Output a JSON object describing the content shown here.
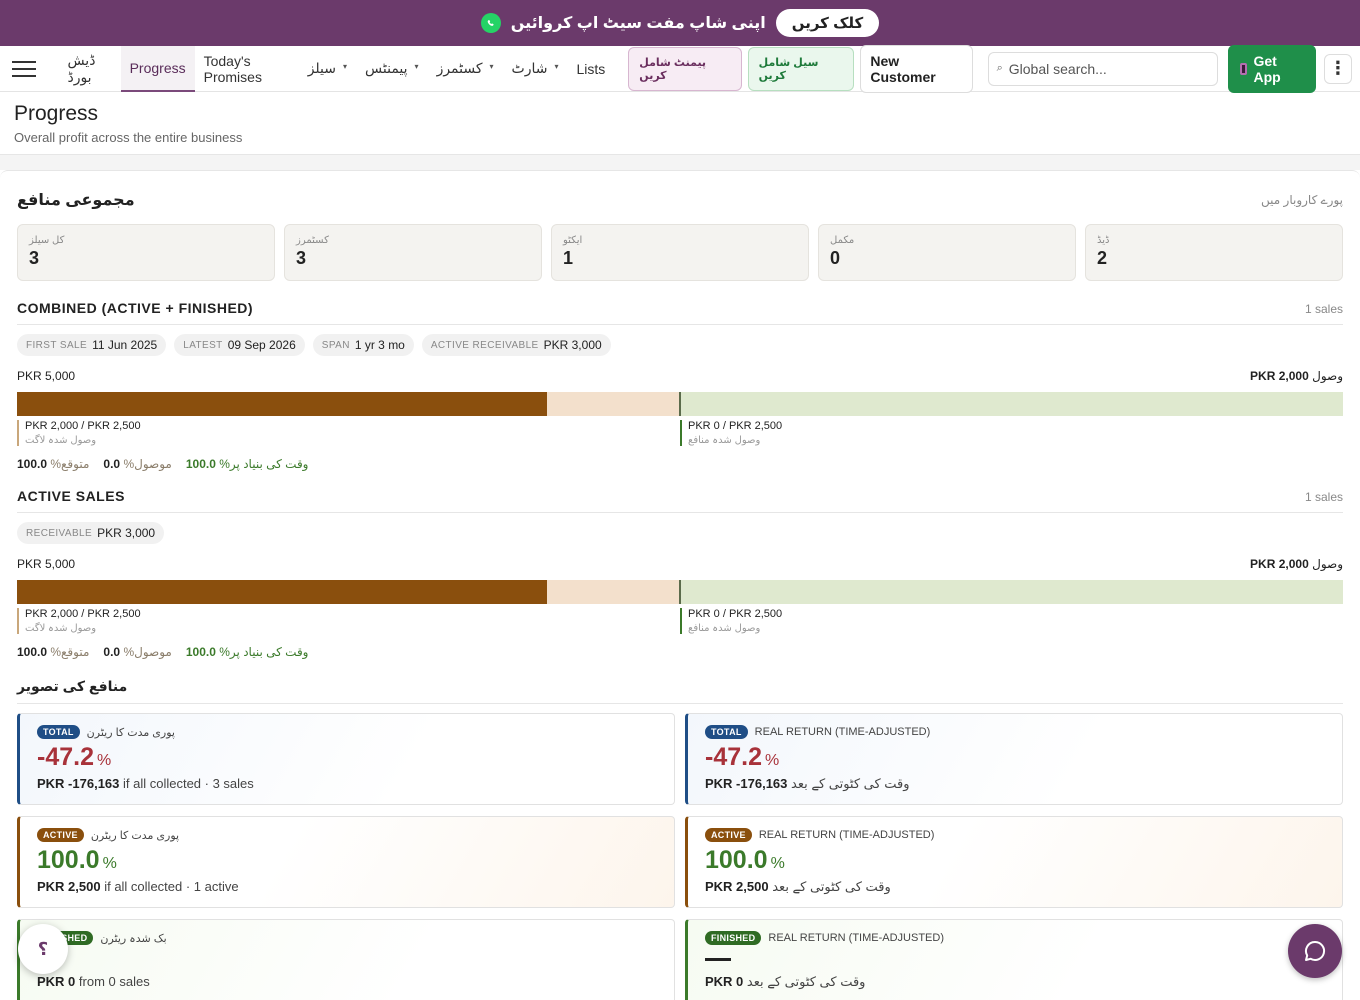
{
  "promo": {
    "text": "اپنی شاپ مفت سیٹ اپ کروائیں",
    "cta": "کلک کریں"
  },
  "nav": {
    "items": [
      {
        "label": "ڈیش بورڈ",
        "has_menu": false,
        "active": false
      },
      {
        "label": "Progress",
        "has_menu": false,
        "active": true
      },
      {
        "label": "Today's Promises",
        "has_menu": false,
        "active": false
      },
      {
        "label": "سیلز",
        "has_menu": true,
        "active": false
      },
      {
        "label": "پیمنٹس",
        "has_menu": true,
        "active": false
      },
      {
        "label": "کسٹمرز",
        "has_menu": true,
        "active": false
      },
      {
        "label": "شارٹ",
        "has_menu": true,
        "active": false
      },
      {
        "label": "Lists",
        "has_menu": false,
        "active": false
      }
    ],
    "add_payment": "پیمنٹ شامل کریں",
    "add_sale": "سیل شامل کریں",
    "new_customer": "New Customer",
    "search_placeholder": "Global search...",
    "get_app": "Get App"
  },
  "page": {
    "title": "Progress",
    "subtitle": "Overall profit across the entire business"
  },
  "overall": {
    "title": "مجموعی منافع",
    "scope": "پورے کاروبار میں",
    "stats": [
      {
        "label": "کل سیلز",
        "value": "3"
      },
      {
        "label": "کسٹمرز",
        "value": "3"
      },
      {
        "label": "ایکٹو",
        "value": "1"
      },
      {
        "label": "مکمل",
        "value": "0"
      },
      {
        "label": "ڈیڈ",
        "value": "2"
      }
    ]
  },
  "combined": {
    "heading": "COMBINED (ACTIVE + FINISHED)",
    "count": "1 sales",
    "chips": [
      {
        "key": "FIRST SALE",
        "value": "11 Jun 2025"
      },
      {
        "key": "LATEST",
        "value": "09 Sep 2026"
      },
      {
        "key": "SPAN",
        "value": "1 yr 3 mo"
      },
      {
        "key": "ACTIVE RECEIVABLE",
        "value": "PKR 3,000"
      }
    ],
    "total_label": "PKR 5,000",
    "received_amount": "PKR 2,000",
    "received_word": "وصول",
    "cost_collected_fraction": 0.8,
    "profit_collected_fraction": 0.0,
    "cost_legend": "PKR 2,000 / PKR 2,500",
    "cost_legend_caption": "وصول شدہ لاگت",
    "profit_legend": "PKR 0 / PKR 2,500",
    "profit_legend_caption": "وصول شدہ منافع",
    "expected_value": "100.0",
    "expected_label": "%متوقع",
    "received_value": "0.0",
    "received_label": "%موصول",
    "ontime_value": "100.0",
    "ontime_label": "%وقت کی بنیاد پر"
  },
  "active": {
    "heading": "ACTIVE SALES",
    "count": "1 sales",
    "chips": [
      {
        "key": "RECEIVABLE",
        "value": "PKR 3,000"
      }
    ],
    "total_label": "PKR 5,000",
    "received_amount": "PKR 2,000",
    "received_word": "وصول",
    "cost_collected_fraction": 0.8,
    "profit_collected_fraction": 0.0,
    "cost_legend": "PKR 2,000 / PKR 2,500",
    "cost_legend_caption": "وصول شدہ لاگت",
    "profit_legend": "PKR 0 / PKR 2,500",
    "profit_legend_caption": "وصول شدہ منافع",
    "expected_value": "100.0",
    "expected_label": "%متوقع",
    "received_value": "0.0",
    "received_label": "%موصول",
    "ontime_value": "100.0",
    "ontime_label": "%وقت کی بنیاد پر"
  },
  "visual": {
    "title": "منافع کی تصویر",
    "cards": [
      {
        "kind": "total",
        "badge": "TOTAL",
        "label": "پوری مدت کا ریٹرن",
        "value": "-47.2",
        "unit": "%",
        "amount": "PKR -176,163",
        "note": " if all collected · 3 sales"
      },
      {
        "kind": "total",
        "badge": "TOTAL",
        "label": "REAL RETURN (TIME-ADJUSTED)",
        "value": "-47.2",
        "unit": "%",
        "amount": "PKR -176,163",
        "note": " وقت کی کٹوتی کے بعد"
      },
      {
        "kind": "active",
        "badge": "ACTIVE",
        "label": "پوری مدت کا ریٹرن",
        "value": "100.0",
        "unit": "%",
        "amount": "PKR 2,500",
        "note": " if all collected · 1 active"
      },
      {
        "kind": "active",
        "badge": "ACTIVE",
        "label": "REAL RETURN (TIME-ADJUSTED)",
        "value": "100.0",
        "unit": "%",
        "amount": "PKR 2,500",
        "note": " وقت کی کٹوتی کے بعد"
      },
      {
        "kind": "finished",
        "badge": "FINISHED",
        "label": "بک شدہ ریٹرن",
        "value": "",
        "unit": "",
        "amount": "PKR 0",
        "note": " from 0 sales"
      },
      {
        "kind": "finished",
        "badge": "FINISHED",
        "label": "REAL RETURN (TIME-ADJUSTED)",
        "value": "",
        "unit": "",
        "amount": "PKR 0",
        "note": " وقت کی کٹوتی کے بعد"
      }
    ]
  },
  "fab": {
    "help": "؟"
  },
  "colors": {
    "brand": "#6b3a6b",
    "cost": "#8a4f0d",
    "pending": "#f3e0cc",
    "profit_track": "#dfe9cf",
    "negative": "#a8323a",
    "positive": "#3b7a2a",
    "get_app": "#1f8f4a"
  }
}
